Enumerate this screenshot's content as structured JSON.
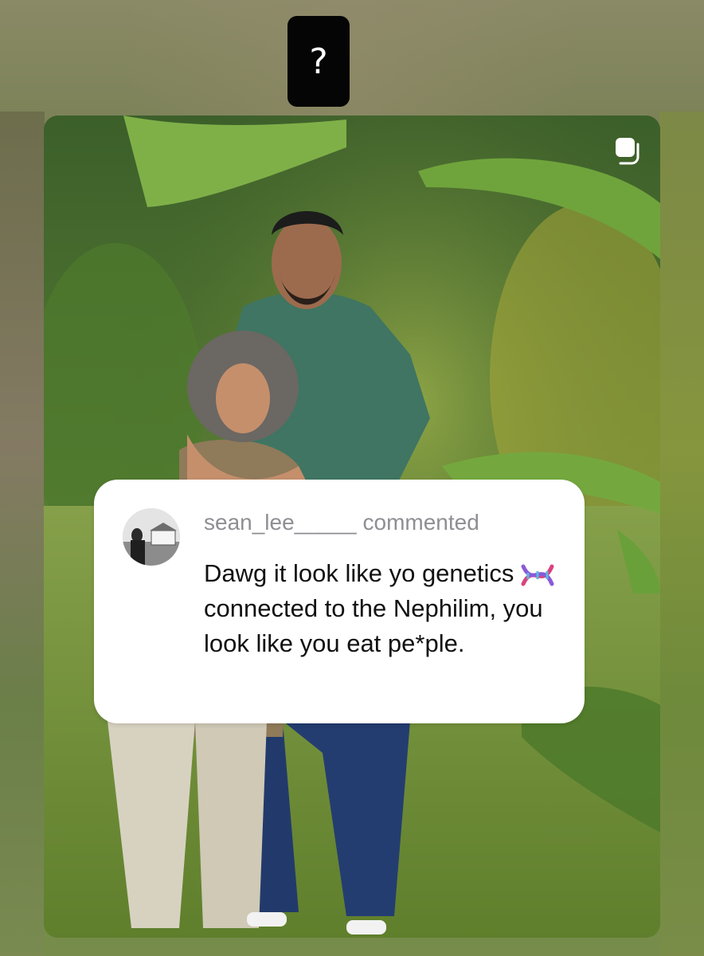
{
  "question_sticker": {
    "label": "?"
  },
  "post": {
    "image_alt": "Photo of a man and a woman standing in a tropical garden",
    "multiple_media_icon": "copy-icon"
  },
  "comment": {
    "username": "sean_lee_____",
    "action": "commented",
    "text_part1": "Dawg it look like yo genetics",
    "emoji": "dna-emoji",
    "text_part2": "connected to the Nephilim, you look like you eat pe*ple."
  },
  "colors": {
    "sticker_bg": "#050505",
    "bubble_bg": "#ffffff",
    "username_gray": "#8e8e93",
    "text_dark": "#111111"
  }
}
